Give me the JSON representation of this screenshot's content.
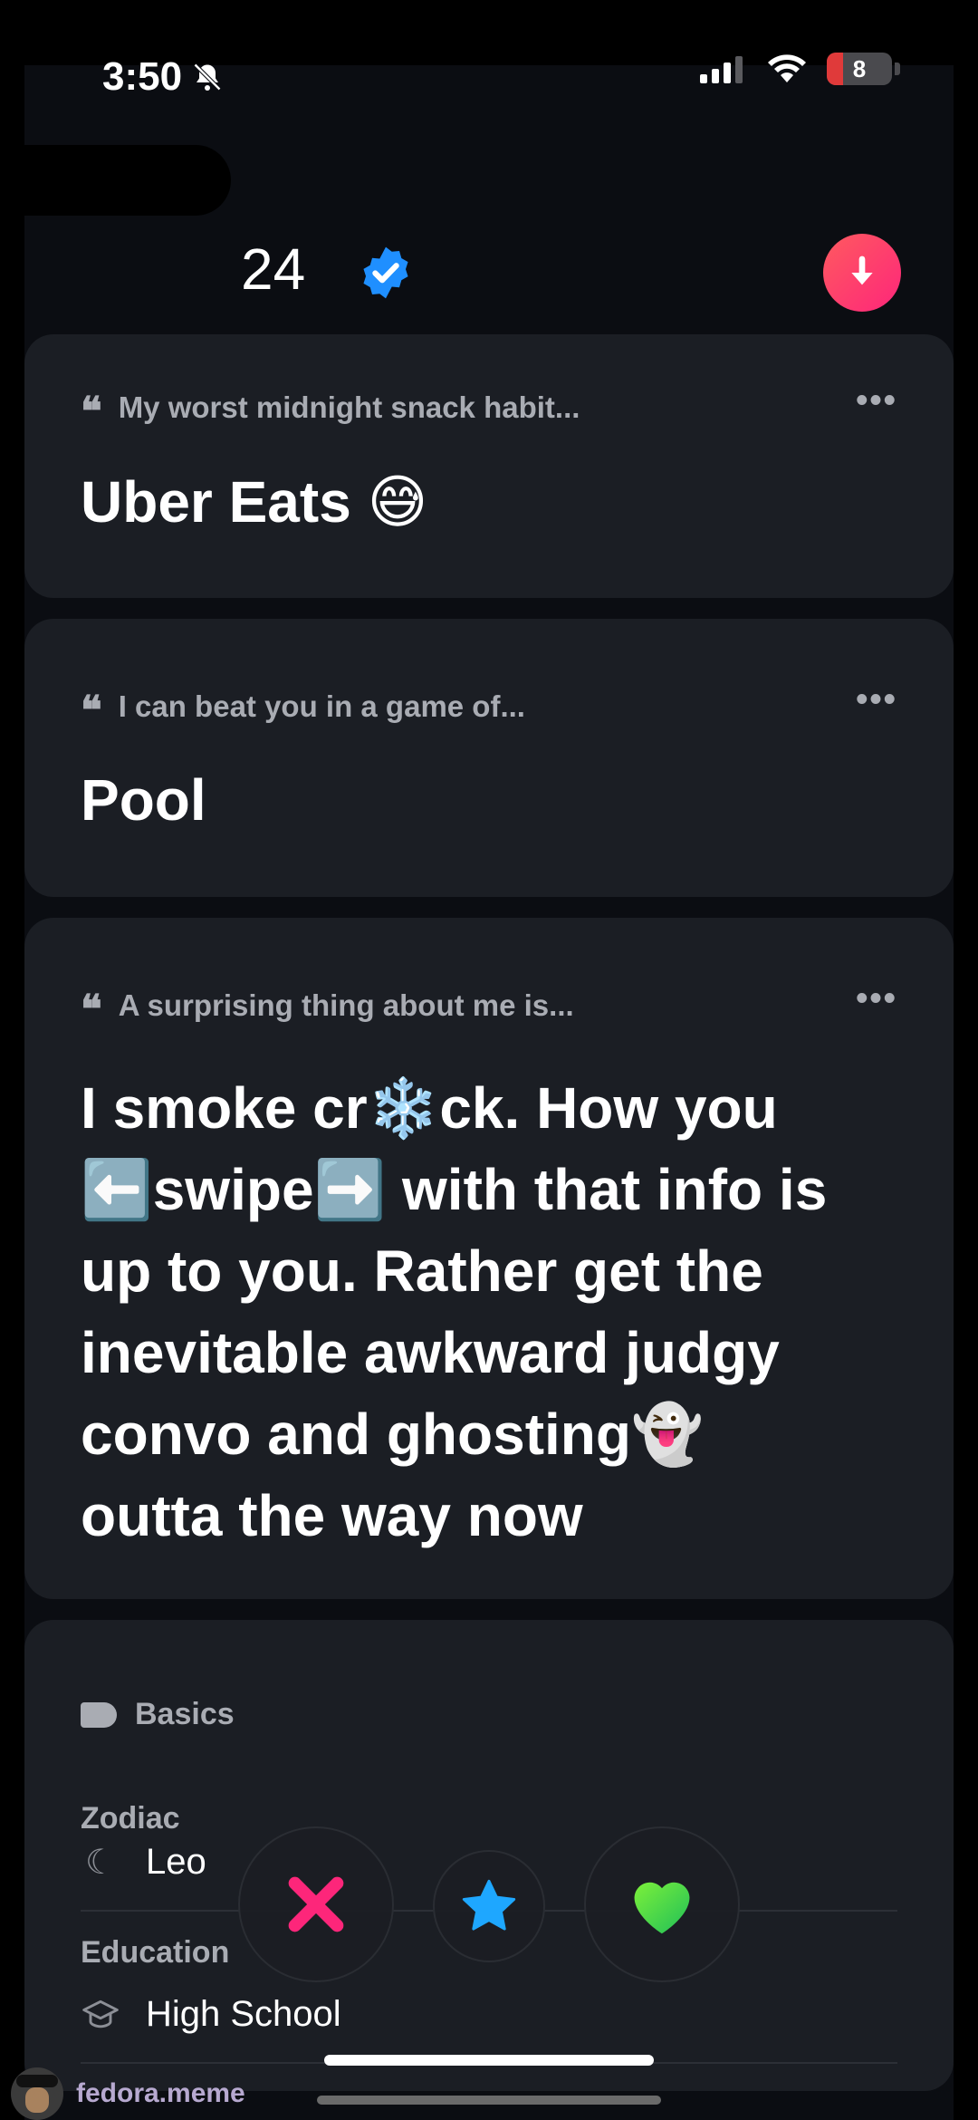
{
  "status_bar": {
    "time": "3:50",
    "battery": "8"
  },
  "profile": {
    "age": "24"
  },
  "prompts": [
    {
      "question": "My worst midnight snack habit...",
      "answer": "Uber Eats 😅"
    },
    {
      "question": "I can beat you in a game of...",
      "answer": "Pool"
    },
    {
      "question": "A surprising thing about me is...",
      "answer_lines": [
        "I smoke cr❄️ck. How you",
        "⬅️swipe➡️ with that info is",
        "up to you. Rather get the",
        "inevitable awkward judgy",
        "convo and ghosting👻",
        "outta the way now"
      ]
    }
  ],
  "basics": {
    "title": "Basics",
    "zodiac_label": "Zodiac",
    "zodiac_value": "Leo",
    "education_label": "Education",
    "education_value": "High School"
  },
  "watermark": "fedora.meme",
  "colors": {
    "accent": "#fd267a",
    "card": "#1b1e24",
    "background": "#0b0d12",
    "muted": "#a9acb3"
  }
}
